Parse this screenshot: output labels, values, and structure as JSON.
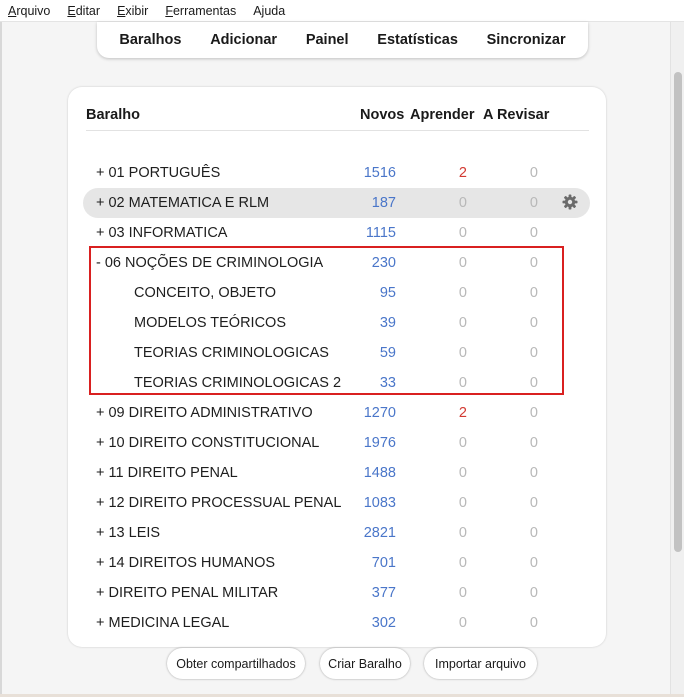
{
  "menu": {
    "items": [
      {
        "label_ul": "A",
        "label_rest": "rquivo"
      },
      {
        "label_ul": "E",
        "label_rest": "ditar"
      },
      {
        "label_ul": "E",
        "label_rest": "xibir"
      },
      {
        "label_ul": "F",
        "label_rest": "erramentas"
      },
      {
        "label_ul": "",
        "label_rest": "Ajuda"
      }
    ]
  },
  "nav": {
    "decks": "Baralhos",
    "add": "Adicionar",
    "panel": "Painel",
    "stats": "Estatísticas",
    "sync": "Sincronizar"
  },
  "table": {
    "headers": {
      "deck": "Baralho",
      "new": "Novos",
      "learn": "Aprender",
      "review": "A Revisar"
    },
    "rows": [
      {
        "name": "+ 01 PORTUGUÊS",
        "new": "1516",
        "learn": "2",
        "review": "0"
      },
      {
        "name": "+ 02 MATEMATICA E RLM",
        "new": "187",
        "learn": "0",
        "review": "0"
      },
      {
        "name": "+ 03 INFORMATICA",
        "new": "1115",
        "learn": "0",
        "review": "0"
      },
      {
        "name": "-  06 NOÇÕES DE CRIMINOLOGIA",
        "new": "230",
        "learn": "0",
        "review": "0"
      },
      {
        "name": "CONCEITO, OBJETO",
        "new": "95",
        "learn": "0",
        "review": "0"
      },
      {
        "name": "MODELOS TEÓRICOS",
        "new": "39",
        "learn": "0",
        "review": "0"
      },
      {
        "name": "TEORIAS CRIMINOLOGICAS",
        "new": "59",
        "learn": "0",
        "review": "0"
      },
      {
        "name": "TEORIAS CRIMINOLOGICAS 2",
        "new": "33",
        "learn": "0",
        "review": "0"
      },
      {
        "name": "+ 09 DIREITO ADMINISTRATIVO",
        "new": "1270",
        "learn": "2",
        "review": "0"
      },
      {
        "name": "+ 10 DIREITO CONSTITUCIONAL",
        "new": "1976",
        "learn": "0",
        "review": "0"
      },
      {
        "name": "+ 11 DIREITO PENAL",
        "new": "1488",
        "learn": "0",
        "review": "0"
      },
      {
        "name": "+ 12 DIREITO PROCESSUAL PENAL",
        "new": "1083",
        "learn": "0",
        "review": "0"
      },
      {
        "name": "+ 13 LEIS",
        "new": "2821",
        "learn": "0",
        "review": "0"
      },
      {
        "name": "+ 14 DIREITOS HUMANOS",
        "new": "701",
        "learn": "0",
        "review": "0"
      },
      {
        "name": "+ DIREITO PENAL MILITAR",
        "new": "377",
        "learn": "0",
        "review": "0"
      },
      {
        "name": "+ MEDICINA LEGAL",
        "new": "302",
        "learn": "0",
        "review": "0"
      }
    ]
  },
  "buttons": {
    "shared": "Obter compartilhados",
    "create": "Criar Baralho",
    "import": "Importar arquivo"
  },
  "colors": {
    "new_count": "#4a76c9",
    "learn_nonzero": "#d23a32",
    "zero_count": "#b8b8b8",
    "annotation_box": "#d92020"
  },
  "icons": {
    "deck_options": "gear-icon"
  }
}
